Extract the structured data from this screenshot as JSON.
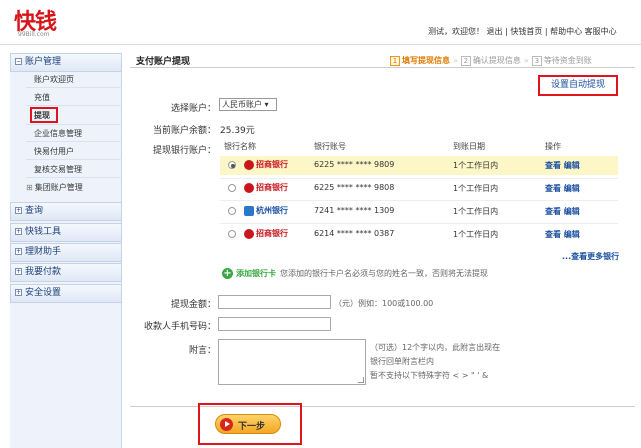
{
  "header": {
    "logo_mark": "快钱",
    "logo_sub": "99Bill.com",
    "top_links": "测试，欢迎您！ 退出 | 快钱首页 | 帮助中心 客服中心"
  },
  "sidebar": {
    "sections": [
      {
        "label": "账户管理",
        "expanded": true
      },
      {
        "label": "查询"
      },
      {
        "label": "快钱工具"
      },
      {
        "label": "理财助手"
      },
      {
        "label": "我要付款"
      },
      {
        "label": "安全设置"
      }
    ],
    "items": [
      "账户欢迎页",
      "充值",
      "提现",
      "企业信息管理",
      "快易付用户",
      "复核交易管理",
      "集团账户管理"
    ]
  },
  "main": {
    "title": "支付账户提现",
    "steps": [
      {
        "num": "1",
        "label": "填写提现信息",
        "active": true
      },
      {
        "num": "2",
        "label": "确认提现信息",
        "active": false
      },
      {
        "num": "3",
        "label": "等待资金到账",
        "active": false
      }
    ],
    "auto_withdraw_button": "设置自动提现",
    "select_account_label": "选择账户：",
    "select_account_value": "人民币账户",
    "balance_label": "当前账户余额：",
    "balance_value": "25.39元",
    "bank_account_label": "提现银行账户：",
    "table": {
      "headers": [
        "银行名称",
        "银行账号",
        "到账日期",
        "操作"
      ],
      "rows": [
        {
          "bank": "招商银行",
          "account": "6225 **** **** 9809",
          "arrival": "1个工作日内",
          "view": "查看",
          "edit": "编辑",
          "selected": true
        },
        {
          "bank": "招商银行",
          "account": "6225 **** **** 9808",
          "arrival": "1个工作日内",
          "view": "查看",
          "edit": "编辑",
          "selected": false
        },
        {
          "bank": "杭州银行",
          "account": "7241 **** **** 1309",
          "arrival": "1个工作日内",
          "view": "查看",
          "edit": "编辑",
          "selected": false
        },
        {
          "bank": "招商银行",
          "account": "6214 **** **** 0387",
          "arrival": "1个工作日内",
          "view": "查看",
          "edit": "编辑",
          "selected": false
        }
      ]
    },
    "more_banks": "...查看更多银行",
    "add_bank_link": "添加银行卡",
    "add_bank_note": "您添加的银行卡户名必须与您的姓名一致，否则将无法提现",
    "amount_label": "提现金额：",
    "amount_hint": "（元）例如：100或100.00",
    "amount_value": "",
    "phone_label": "收款人手机号码：",
    "phone_value": "",
    "remark_label": "附言：",
    "remark_hint_1": "（可选）12个字以内，此附言出现在",
    "remark_hint_2": "银行回单附言栏内",
    "remark_hint_3": "暂不支持以下特殊字符 < > \" ' &",
    "next_button": "下一步"
  },
  "colors": {
    "brand_red": "#d7141a",
    "link_blue": "#1a4fa0",
    "step_active": "#e47b00",
    "selected_row": "#fdf7c8",
    "button_orange": "#f5a623"
  }
}
